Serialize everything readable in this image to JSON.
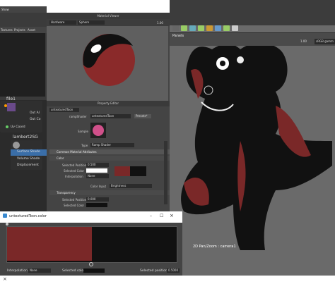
{
  "colors": {
    "accent": "#7a2828",
    "selected": "#4a90d9",
    "dark": "#202020"
  },
  "hypershade": {
    "tabs": [
      "Show"
    ],
    "panel_tabs": [
      "Textures",
      "Projects",
      "Asset"
    ],
    "node1_label": "file1",
    "node1_ports": [
      "Out Al",
      "Out Co",
      "Uv Coord"
    ],
    "node2_label": "lambert2SG",
    "node2_ports": [
      "Surface Shade",
      "Volume Shade",
      "Displacement"
    ]
  },
  "material_viewer": {
    "title": "Material Viewer",
    "renderer": "Hardware",
    "shape": "Sphere",
    "zoom": "1.00"
  },
  "property_editor": {
    "title": "Property Editor",
    "node_name": "untexturedToon",
    "type_label": "rampShader",
    "type_value": "untexturedToon",
    "presets_label": "Presets*",
    "sample_label": "Sample",
    "shader_type_label": "Type",
    "shader_type_value": "Ramp Shader",
    "section_common": "Common Material Attributes",
    "section_color": "Color",
    "selected_position_label": "Selected Position",
    "selected_position_value": "0.500",
    "selected_color_label": "Selected Color",
    "interpolation_label": "Interpolation",
    "interpolation_value": "None",
    "color_input_label": "Color Input",
    "color_input_value": "Brightness",
    "section_transparency": "Transparency",
    "t_selected_position_label": "Selected Position",
    "t_selected_position_value": "0.000",
    "t_selected_color_label": "Selected Color"
  },
  "viewport": {
    "panel_label": "Panels",
    "zoom": "1.00",
    "color_space": "sRGB gamm",
    "camera_label": "2D Pan/Zoom : camera1"
  },
  "ramp_editor": {
    "title": "untexturedToon.color",
    "interpolation_label": "Interpolation",
    "interpolation_value": "None",
    "selected_colour_label": "Selected colour",
    "selected_position_label": "Selected position",
    "selected_position_value": "0.5000"
  },
  "bottom": {
    "close_label": "×"
  }
}
